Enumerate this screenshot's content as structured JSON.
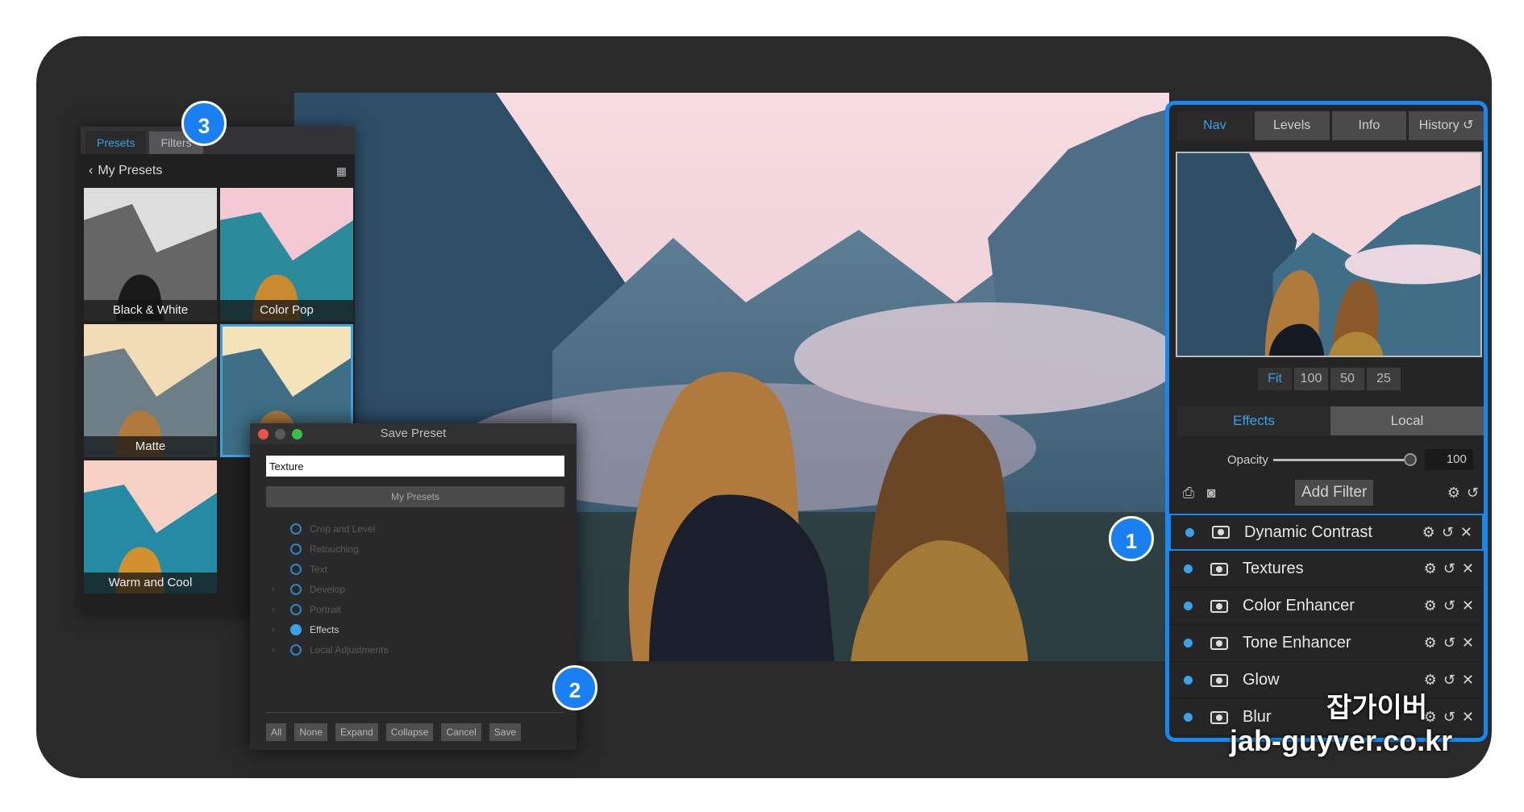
{
  "presets_panel": {
    "tabs": [
      "Presets",
      "Filters"
    ],
    "header": "My Presets",
    "thumbnails": [
      {
        "label": "Black & White"
      },
      {
        "label": "Color Pop"
      },
      {
        "label": "Matte"
      },
      {
        "label": ""
      },
      {
        "label": "Warm and Cool"
      }
    ]
  },
  "save_dialog": {
    "title": "Save Preset",
    "name_value": "Texture",
    "group_label": "My Presets",
    "options": [
      "Crop and Level",
      "Retouching",
      "Text",
      "Develop",
      "Portrait",
      "Effects",
      "Local Adjustments"
    ],
    "selected_option": "Effects",
    "buttons": [
      "All",
      "None",
      "Expand",
      "Collapse",
      "Cancel",
      "Save"
    ]
  },
  "right_panel": {
    "tabs": [
      "Nav",
      "Levels",
      "Info",
      "History"
    ],
    "zoom": [
      "Fit",
      "100",
      "50",
      "25"
    ],
    "segments": [
      "Effects",
      "Local"
    ],
    "opacity_label": "Opacity",
    "opacity_value": "100",
    "add_filter_label": "Add Filter",
    "filters": [
      "Dynamic Contrast",
      "Textures",
      "Color Enhancer",
      "Tone Enhancer",
      "Glow",
      "Blur"
    ]
  },
  "badges": [
    "1",
    "2",
    "3"
  ],
  "watermark": {
    "line1": "잡가이버",
    "line2": "jab-guyver.co.kr"
  },
  "colors": {
    "accent": "#3aa3e8",
    "frame": "#1688f0",
    "badge": "#1a7ff0",
    "bg": "#2a2a2b"
  }
}
